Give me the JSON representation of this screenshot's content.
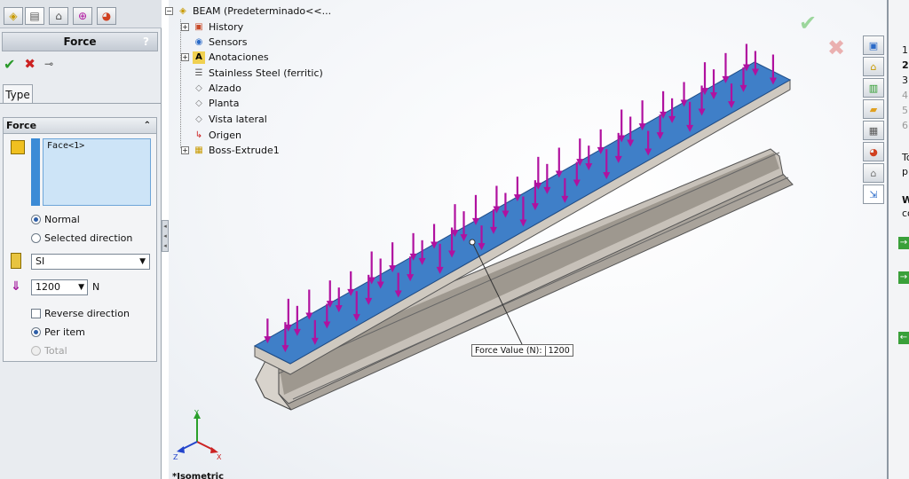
{
  "property_manager": {
    "title": "Force",
    "help": "?",
    "type_tab": "Type",
    "group_title": "Force",
    "selection": "Face<1>",
    "options": {
      "normal": "Normal",
      "selected_direction": "Selected direction",
      "reverse_direction": "Reverse direction",
      "per_item": "Per item",
      "total": "Total"
    },
    "units": "SI",
    "force_value": "1200",
    "force_unit": "N"
  },
  "tree": {
    "root": "BEAM  (Predeterminado<<...",
    "items": [
      {
        "label": "History",
        "expandable": true
      },
      {
        "label": "Sensors",
        "expandable": false
      },
      {
        "label": "Anotaciones",
        "expandable": true
      },
      {
        "label": "Stainless Steel (ferritic)",
        "expandable": false
      },
      {
        "label": "Alzado",
        "expandable": false
      },
      {
        "label": "Planta",
        "expandable": false
      },
      {
        "label": "Vista lateral",
        "expandable": false
      },
      {
        "label": "Origen",
        "expandable": false
      },
      {
        "label": "Boss-Extrude1",
        "expandable": true
      }
    ]
  },
  "viewport": {
    "callout_label": "Force Value (N):",
    "callout_value": "1200",
    "view_name": "*Isometric",
    "triad": {
      "x": "X",
      "y": "Y",
      "z": "Z"
    }
  },
  "right_panel": {
    "rows": [
      "1",
      "2",
      "3",
      "4",
      "5",
      "6"
    ],
    "text1": "To",
    "text2": "pr",
    "text3": "Wa",
    "text4": "co"
  },
  "colors": {
    "force_arrow": "#b0119f",
    "top_face": "#3f7fc8",
    "beam_steel": "#b9b3ab",
    "selection": "#cde4f7"
  }
}
